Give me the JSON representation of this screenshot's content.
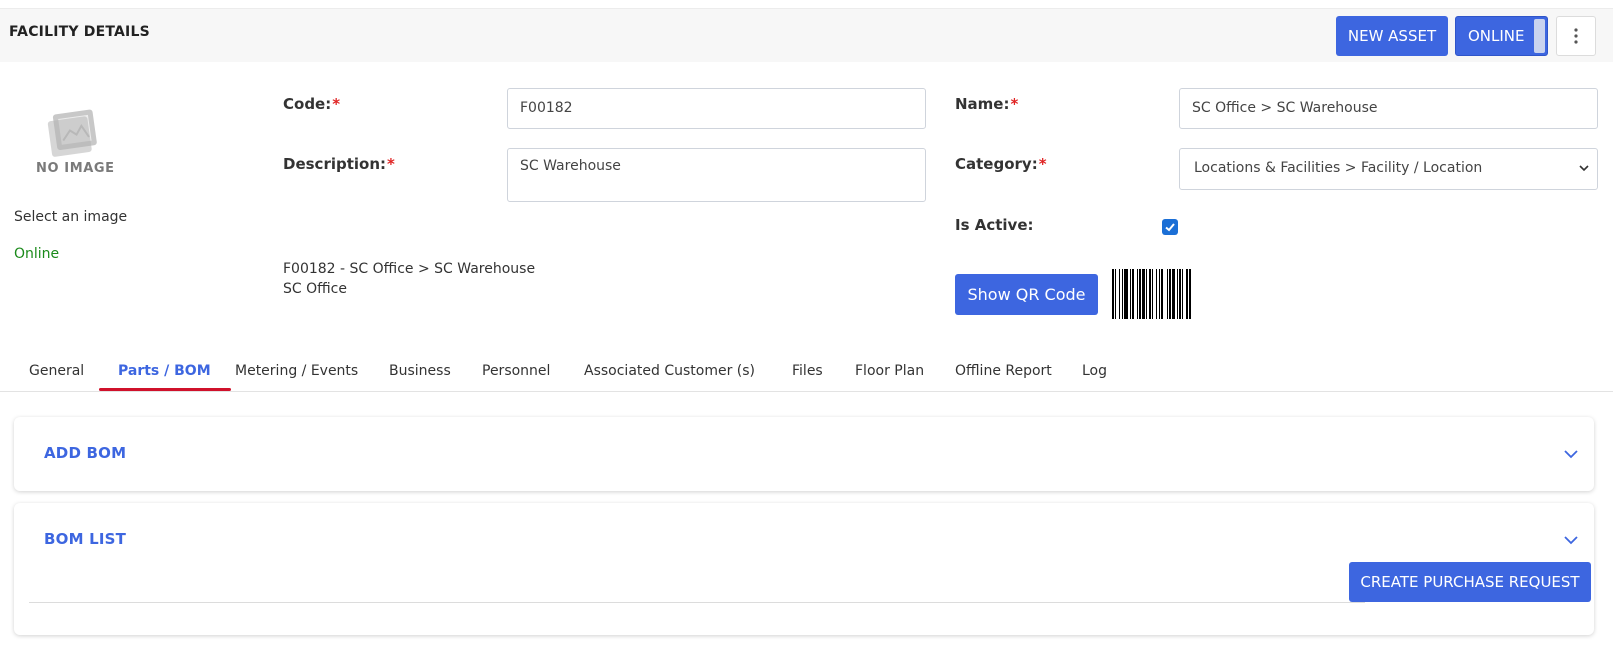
{
  "header": {
    "title": "FACILITY DETAILS",
    "new_asset_label": "NEW ASSET",
    "online_toggle_label": "ONLINE",
    "more_icon": "vertical-dots-icon"
  },
  "image_panel": {
    "placeholder_label": "NO IMAGE",
    "select_image_label": "Select an image",
    "status": "Online"
  },
  "form": {
    "code": {
      "label": "Code:",
      "value": "F00182"
    },
    "description": {
      "label": "Description:",
      "value": "SC Warehouse"
    },
    "name": {
      "label": "Name:",
      "value": "SC Office > SC Warehouse"
    },
    "category": {
      "label": "Category:",
      "value": "Locations & Facilities > Facility / Location"
    },
    "is_active": {
      "label": "Is Active:",
      "checked": true
    },
    "required_marker": "*"
  },
  "summary": {
    "line1": "F00182 - SC Office > SC Warehouse",
    "line2": "SC Office"
  },
  "qr_button_label": "Show QR Code",
  "tabs": [
    {
      "label": "General",
      "active": false
    },
    {
      "label": "Parts / BOM",
      "active": true
    },
    {
      "label": "Metering / Events",
      "active": false
    },
    {
      "label": "Business",
      "active": false
    },
    {
      "label": "Personnel",
      "active": false
    },
    {
      "label": "Associated Customer (s)",
      "active": false
    },
    {
      "label": "Files",
      "active": false
    },
    {
      "label": "Floor Plan",
      "active": false
    },
    {
      "label": "Offline Report",
      "active": false
    },
    {
      "label": "Log",
      "active": false
    }
  ],
  "panels": {
    "add_bom": {
      "title": "ADD BOM"
    },
    "bom_list": {
      "title": "BOM LIST",
      "create_pr_label": "CREATE PURCHASE REQUEST"
    }
  },
  "colors": {
    "accent": "#3d66e0",
    "required": "#e02424",
    "status_online": "#1a8a1a",
    "tab_underline": "#d0112b",
    "checkbox": "#1b6fd6"
  }
}
